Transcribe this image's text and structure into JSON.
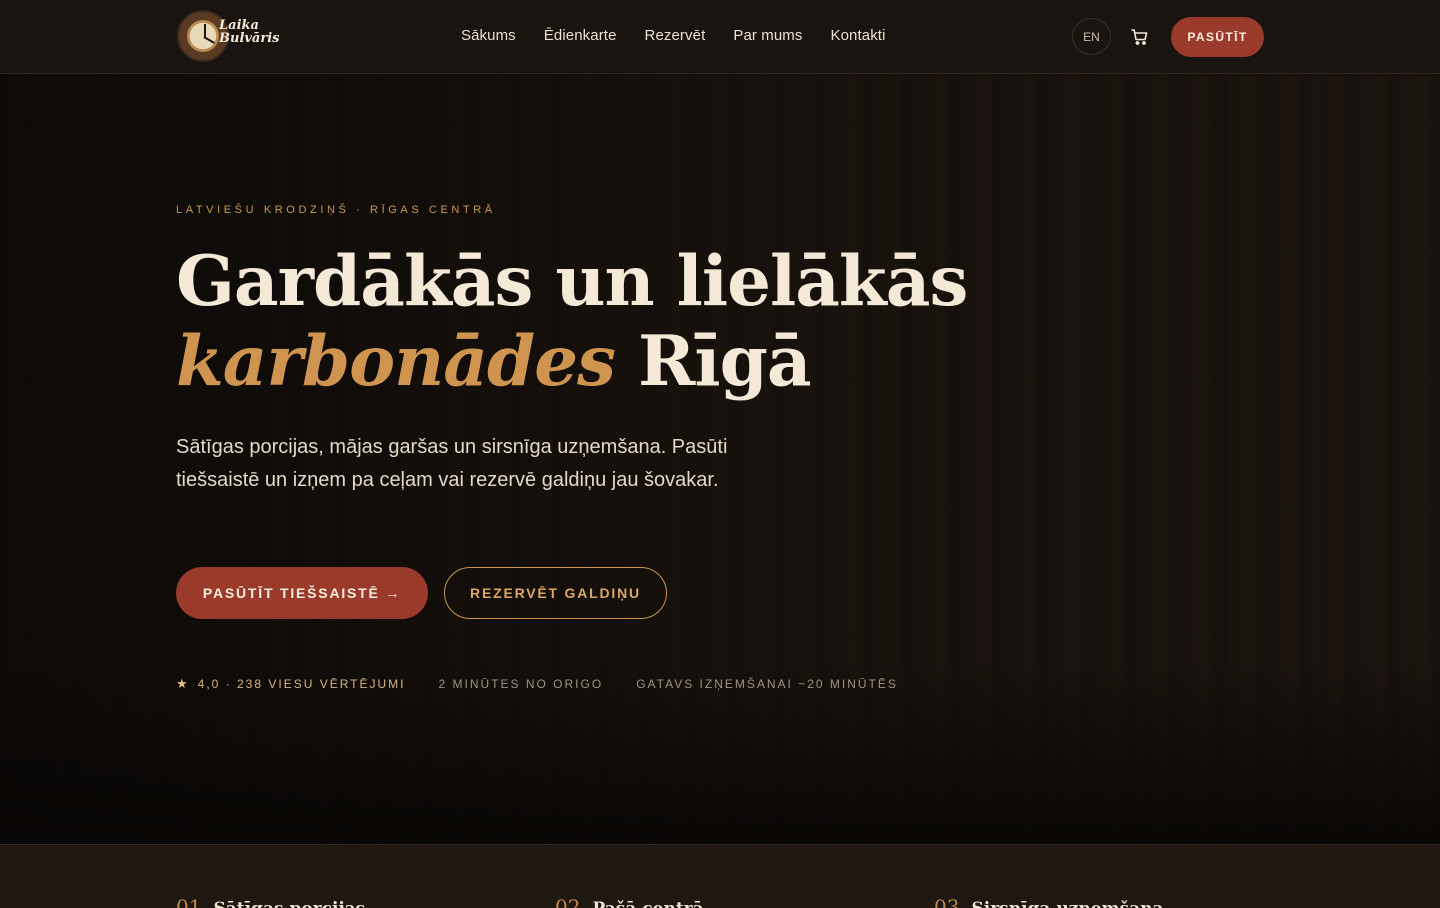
{
  "brand": {
    "logo_line1": "Laika",
    "logo_line2": "Bulvāris"
  },
  "nav": {
    "items": [
      "Sākums",
      "Ēdienkarte",
      "Rezervēt",
      "Par mums",
      "Kontakti"
    ],
    "lang": "EN",
    "order_label": "PASŪTĪT"
  },
  "hero": {
    "eyebrow": "LATVIEŠU KRODZIŅŠ · RĪGAS CENTRĀ",
    "title_line1": "Gardākās un lielākās",
    "title_accent": "karbonādes",
    "title_rest": " Rīgā",
    "lead": "Sātīgas porcijas, mājas garšas un sirsnīga uzņemšana. Pasūti tiešsaistē un izņem pa ceļam vai rezervē galdiņu jau šovakar.",
    "primary_cta": "PASŪTĪT TIEŠSAISTĒ →",
    "secondary_cta": "REZERVĒT GALDIŅU",
    "stats": {
      "rating": "4,0 · 238 VIESU VĒRTĒJUMI",
      "distance": "2 MINŪTES NO ORIGO",
      "pickup": "GATAVS IZŅEMŠANAI ~20 MINŪTĒS"
    }
  },
  "features": [
    {
      "num": "01",
      "name": "Sātīgas porcijas"
    },
    {
      "num": "02",
      "name": "Pašā centrā"
    },
    {
      "num": "03",
      "name": "Sirsnīga uzņemšana"
    }
  ],
  "colors": {
    "accent_red": "#9a3a2a",
    "accent_gold": "#cf9550",
    "background": "#0b0806"
  },
  "icons": {
    "cart": "cart-icon",
    "star": "star-icon",
    "clock_logo": "clock-logo-icon"
  }
}
